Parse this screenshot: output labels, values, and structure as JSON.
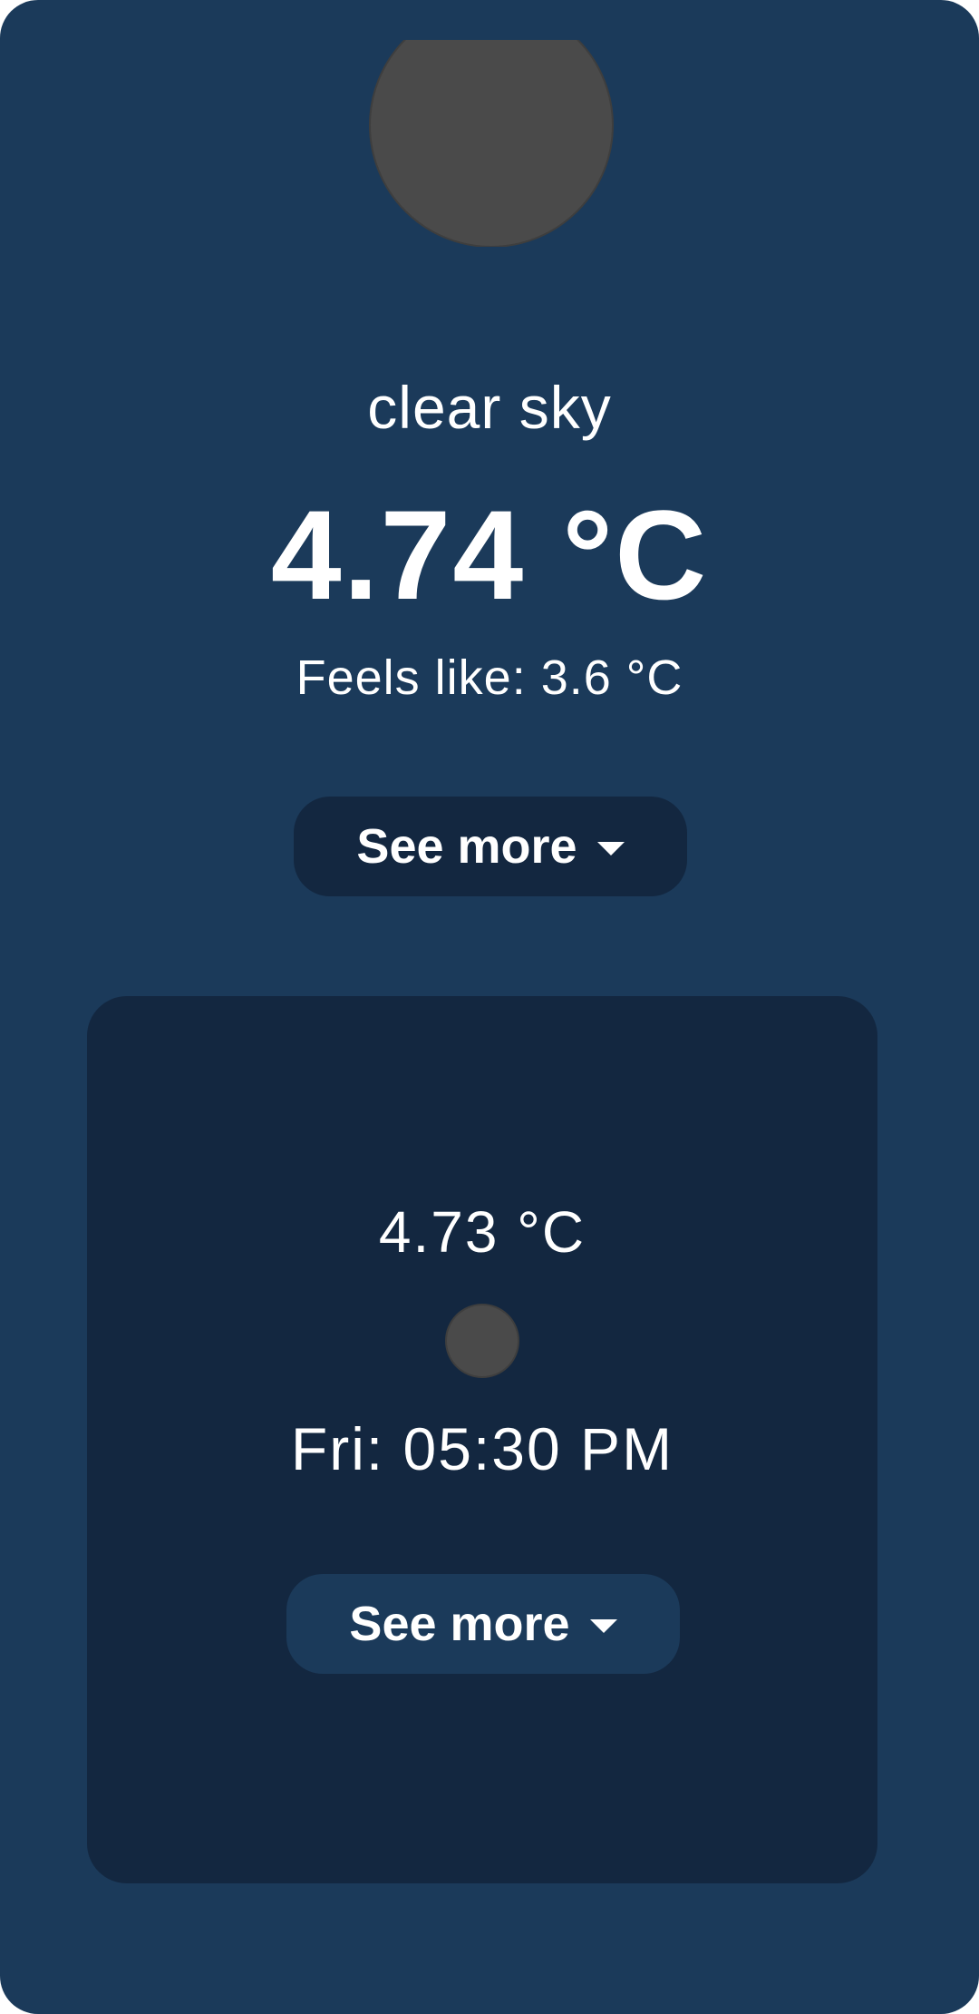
{
  "current": {
    "icon": "weather-icon",
    "condition": "clear sky",
    "temperature": "4.74 °C",
    "feels_like": "Feels like: 3.6 °C",
    "see_more_label": "See more"
  },
  "forecast": {
    "temperature": "4.73 °C",
    "icon": "weather-icon",
    "time": "Fri: 05:30 PM",
    "see_more_label": "See more"
  },
  "colors": {
    "background": "#1b3a5a",
    "card": "#132740",
    "text": "#ffffff",
    "icon_placeholder": "#4a4a4a"
  }
}
